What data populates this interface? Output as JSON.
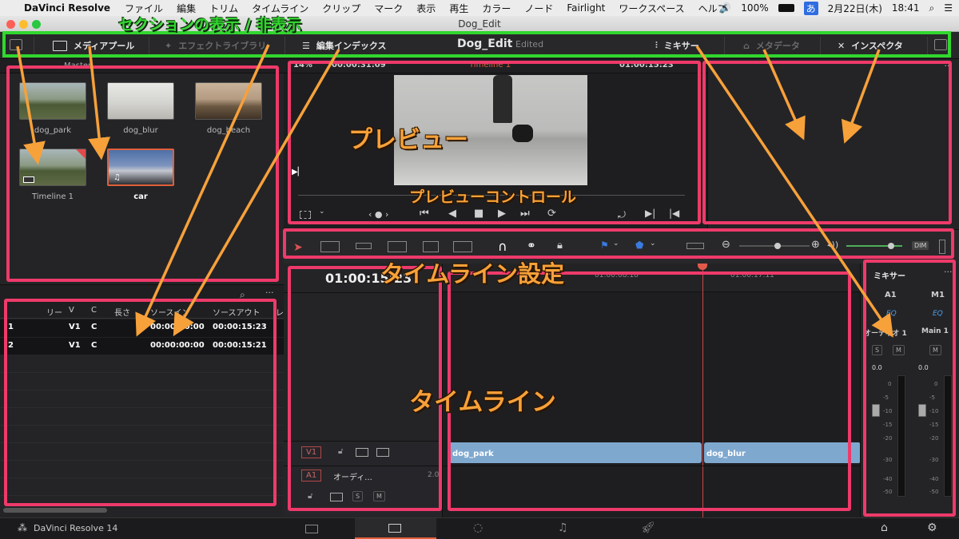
{
  "menubar": {
    "app_name": "DaVinci Resolve",
    "items": [
      "ファイル",
      "編集",
      "トリム",
      "タイムライン",
      "クリップ",
      "マーク",
      "表示",
      "再生",
      "カラー",
      "ノード",
      "Fairlight",
      "ワークスペース",
      "ヘルプ"
    ],
    "battery": "100%",
    "ime": "あ",
    "date": "2月22日(木)",
    "time": "18:41"
  },
  "window": {
    "title": "Dog_Edit"
  },
  "toolbar": {
    "media_pool": "メディアプール",
    "effects_library": "エフェクトライブラリ",
    "edit_index": "編集インデックス",
    "project_name": "Dog_Edit",
    "project_status": "Edited",
    "mixer": "ミキサー",
    "metadata": "メタデータ",
    "inspector": "インスペクタ"
  },
  "viewer": {
    "zoom": "14%",
    "in_tc": "00:00:31:09",
    "timeline_name": "Timeline 1",
    "out_tc": "01:00:15:23"
  },
  "media_pool": {
    "bin_label": "Master",
    "clips": [
      {
        "name": "dog_park"
      },
      {
        "name": "dog_blur"
      },
      {
        "name": "dog_beach"
      },
      {
        "name": "Timeline 1"
      },
      {
        "name": "car"
      }
    ]
  },
  "edit_index": {
    "columns": [
      "リー",
      "V",
      "C",
      "長さ",
      "ソースイン",
      "ソースアウト",
      "レ"
    ],
    "rows": [
      [
        "1",
        "V1",
        "C",
        "",
        "00:00:00:00",
        "00:00:15:23"
      ],
      [
        "2",
        "V1",
        "C",
        "",
        "00:00:00:00",
        "00:00:15:21"
      ]
    ]
  },
  "timeline": {
    "timecode": "01:00:15:23",
    "ruler": [
      "01:00:08:18",
      "01:00:17:11"
    ],
    "v1_label": "V1",
    "a1_label": "A1",
    "a1_name": "オーディ...",
    "a1_level": "2.0",
    "s_btn": "S",
    "m_btn": "M",
    "clips": [
      "dog_park",
      "dog_blur"
    ]
  },
  "mixer": {
    "title": "ミキサー",
    "ch1": "A1",
    "ch2": "M1",
    "eq": "EQ",
    "ch1_name": "オーディオ 1",
    "ch2_name": "Main 1",
    "ch1_level": "0.0",
    "ch2_level": "0.0",
    "scale": [
      "0",
      "-5",
      "-10",
      "-15",
      "-20",
      "-30",
      "-40",
      "-50"
    ],
    "dim": "DIM"
  },
  "statusbar": {
    "app_label": "DaVinci Resolve 14"
  },
  "annotations": {
    "sections_toggle": "セクションの表示 / 非表示",
    "preview": "プレビュー",
    "preview_controls": "プレビューコントロール",
    "timeline_settings": "タイムライン設定",
    "timeline": "タイムライン"
  },
  "colors": {
    "annotation_box": "#ee3a6a",
    "annotation_green": "#31d72e",
    "annotation_text": "#f7a13a",
    "clip_blue": "#7fa8cf"
  }
}
